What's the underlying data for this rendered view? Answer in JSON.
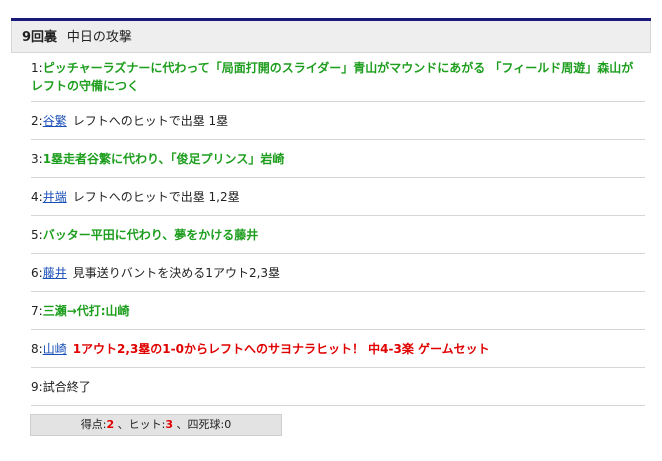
{
  "header": {
    "inning": "9回裏",
    "team_attack": "中日の攻撃"
  },
  "plays": [
    {
      "num": "1:",
      "player": "",
      "text": "ピッチャーラズナーに代わって「局面打開のスライダー」青山がマウンドにあがる 「フィールド周遊」森山がレフトの守備につく",
      "style": "green"
    },
    {
      "num": "2:",
      "player": "谷繁",
      "text": "レフトへのヒットで出塁 1塁",
      "style": "plain"
    },
    {
      "num": "3:",
      "player": "",
      "text": "1塁走者谷繁に代わり、「俊足プリンス」岩崎",
      "style": "green"
    },
    {
      "num": "4:",
      "player": "井端",
      "text": "レフトへのヒットで出塁 1,2塁",
      "style": "plain"
    },
    {
      "num": "5:",
      "player": "",
      "text": "バッター平田に代わり、夢をかける藤井",
      "style": "green"
    },
    {
      "num": "6:",
      "player": "藤井",
      "text": "見事送りバントを決める1アウト2,3塁",
      "style": "plain"
    },
    {
      "num": "7:",
      "player": "",
      "text": "三瀬→代打:山崎",
      "style": "green"
    },
    {
      "num": "8:",
      "player": "山崎",
      "text": "1アウト2,3塁の1-0からレフトへのサヨナラヒット！ 中4-3楽 ゲームセット",
      "style": "red"
    },
    {
      "num": "9:",
      "player": "",
      "text": "試合終了",
      "style": "plain"
    }
  ],
  "summary": {
    "runs_label": "得点:",
    "runs": "2",
    "sep1": "、",
    "hits_label": "ヒット:",
    "hits": "3",
    "sep2": "、",
    "walks_label": "四死球:",
    "walks": "0"
  },
  "colors": {
    "green": "#1e9e1e",
    "red": "#e00000",
    "link": "#1a4fb8",
    "topline": "#1a1a7a"
  }
}
